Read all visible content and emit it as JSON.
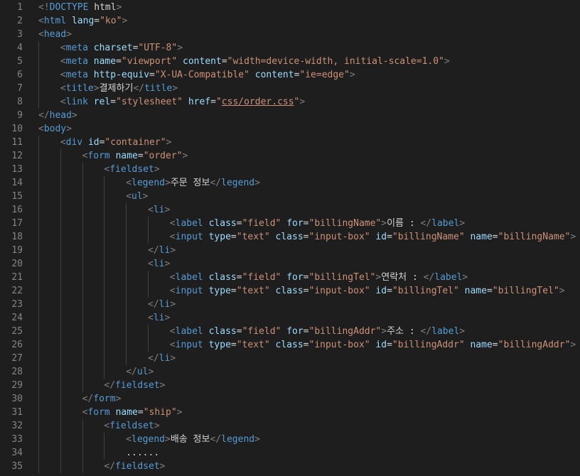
{
  "colors": {
    "background": "#1e1e1e",
    "line_number": "#858585",
    "indent_guide": "#404040",
    "bracket": "#808080",
    "tag": "#569cd6",
    "attribute": "#9cdcfe",
    "string": "#ce9178",
    "text": "#d4d4d4"
  },
  "lines": [
    {
      "n": "1",
      "indent": 0,
      "tokens": [
        [
          "bracket",
          "<!"
        ],
        [
          "tag",
          "DOCTYPE"
        ],
        [
          "text",
          " "
        ],
        [
          "kw",
          "html"
        ],
        [
          "bracket",
          ">"
        ]
      ]
    },
    {
      "n": "2",
      "indent": 0,
      "tokens": [
        [
          "bracket",
          "<"
        ],
        [
          "tag",
          "html"
        ],
        [
          "text",
          " "
        ],
        [
          "attr",
          "lang"
        ],
        [
          "eq",
          "="
        ],
        [
          "str",
          "\"ko\""
        ],
        [
          "bracket",
          ">"
        ]
      ]
    },
    {
      "n": "3",
      "indent": 0,
      "tokens": [
        [
          "bracket",
          "<"
        ],
        [
          "tag",
          "head"
        ],
        [
          "bracket",
          ">"
        ]
      ]
    },
    {
      "n": "4",
      "indent": 1,
      "tokens": [
        [
          "bracket",
          "<"
        ],
        [
          "tag",
          "meta"
        ],
        [
          "text",
          " "
        ],
        [
          "attr",
          "charset"
        ],
        [
          "eq",
          "="
        ],
        [
          "str",
          "\"UTF-8\""
        ],
        [
          "bracket",
          ">"
        ]
      ]
    },
    {
      "n": "5",
      "indent": 1,
      "tokens": [
        [
          "bracket",
          "<"
        ],
        [
          "tag",
          "meta"
        ],
        [
          "text",
          " "
        ],
        [
          "attr",
          "name"
        ],
        [
          "eq",
          "="
        ],
        [
          "str",
          "\"viewport\""
        ],
        [
          "text",
          " "
        ],
        [
          "attr",
          "content"
        ],
        [
          "eq",
          "="
        ],
        [
          "str",
          "\"width=device-width, initial-scale=1.0\""
        ],
        [
          "bracket",
          ">"
        ]
      ]
    },
    {
      "n": "6",
      "indent": 1,
      "tokens": [
        [
          "bracket",
          "<"
        ],
        [
          "tag",
          "meta"
        ],
        [
          "text",
          " "
        ],
        [
          "attr",
          "http-equiv"
        ],
        [
          "eq",
          "="
        ],
        [
          "str",
          "\"X-UA-Compatible\""
        ],
        [
          "text",
          " "
        ],
        [
          "attr",
          "content"
        ],
        [
          "eq",
          "="
        ],
        [
          "str",
          "\"ie=edge\""
        ],
        [
          "bracket",
          ">"
        ]
      ]
    },
    {
      "n": "7",
      "indent": 1,
      "tokens": [
        [
          "bracket",
          "<"
        ],
        [
          "tag",
          "title"
        ],
        [
          "bracket",
          ">"
        ],
        [
          "text",
          "결제하기"
        ],
        [
          "bracket",
          "</"
        ],
        [
          "tag",
          "title"
        ],
        [
          "bracket",
          ">"
        ]
      ]
    },
    {
      "n": "8",
      "indent": 1,
      "tokens": [
        [
          "bracket",
          "<"
        ],
        [
          "tag",
          "link"
        ],
        [
          "text",
          " "
        ],
        [
          "attr",
          "rel"
        ],
        [
          "eq",
          "="
        ],
        [
          "str",
          "\"stylesheet\""
        ],
        [
          "text",
          " "
        ],
        [
          "attr",
          "href"
        ],
        [
          "eq",
          "="
        ],
        [
          "str",
          "\""
        ],
        [
          "link",
          "css/order.css"
        ],
        [
          "str",
          "\""
        ],
        [
          "bracket",
          ">"
        ]
      ]
    },
    {
      "n": "9",
      "indent": 0,
      "tokens": [
        [
          "bracket",
          "</"
        ],
        [
          "tag",
          "head"
        ],
        [
          "bracket",
          ">"
        ]
      ]
    },
    {
      "n": "10",
      "indent": 0,
      "tokens": [
        [
          "bracket",
          "<"
        ],
        [
          "tag",
          "body"
        ],
        [
          "bracket",
          ">"
        ]
      ]
    },
    {
      "n": "11",
      "indent": 1,
      "tokens": [
        [
          "bracket",
          "<"
        ],
        [
          "tag",
          "div"
        ],
        [
          "text",
          " "
        ],
        [
          "attr",
          "id"
        ],
        [
          "eq",
          "="
        ],
        [
          "str",
          "\"container\""
        ],
        [
          "bracket",
          ">"
        ]
      ]
    },
    {
      "n": "12",
      "indent": 2,
      "tokens": [
        [
          "bracket",
          "<"
        ],
        [
          "tag",
          "form"
        ],
        [
          "text",
          " "
        ],
        [
          "attr",
          "name"
        ],
        [
          "eq",
          "="
        ],
        [
          "str",
          "\"order\""
        ],
        [
          "bracket",
          ">"
        ]
      ]
    },
    {
      "n": "13",
      "indent": 3,
      "tokens": [
        [
          "bracket",
          "<"
        ],
        [
          "tag",
          "fieldset"
        ],
        [
          "bracket",
          ">"
        ]
      ]
    },
    {
      "n": "14",
      "indent": 4,
      "tokens": [
        [
          "bracket",
          "<"
        ],
        [
          "tag",
          "legend"
        ],
        [
          "bracket",
          ">"
        ],
        [
          "text",
          "주문 정보"
        ],
        [
          "bracket",
          "</"
        ],
        [
          "tag",
          "legend"
        ],
        [
          "bracket",
          ">"
        ]
      ]
    },
    {
      "n": "15",
      "indent": 4,
      "tokens": [
        [
          "bracket",
          "<"
        ],
        [
          "tag",
          "ul"
        ],
        [
          "bracket",
          ">"
        ]
      ]
    },
    {
      "n": "16",
      "indent": 5,
      "tokens": [
        [
          "bracket",
          "<"
        ],
        [
          "tag",
          "li"
        ],
        [
          "bracket",
          ">"
        ]
      ]
    },
    {
      "n": "17",
      "indent": 6,
      "tokens": [
        [
          "bracket",
          "<"
        ],
        [
          "tag",
          "label"
        ],
        [
          "text",
          " "
        ],
        [
          "attr",
          "class"
        ],
        [
          "eq",
          "="
        ],
        [
          "str",
          "\"field\""
        ],
        [
          "text",
          " "
        ],
        [
          "attr",
          "for"
        ],
        [
          "eq",
          "="
        ],
        [
          "str",
          "\"billingName\""
        ],
        [
          "bracket",
          ">"
        ],
        [
          "text",
          "이름 : "
        ],
        [
          "bracket",
          "</"
        ],
        [
          "tag",
          "label"
        ],
        [
          "bracket",
          ">"
        ]
      ]
    },
    {
      "n": "18",
      "indent": 6,
      "tokens": [
        [
          "bracket",
          "<"
        ],
        [
          "tag",
          "input"
        ],
        [
          "text",
          " "
        ],
        [
          "attr",
          "type"
        ],
        [
          "eq",
          "="
        ],
        [
          "str",
          "\"text\""
        ],
        [
          "text",
          " "
        ],
        [
          "attr",
          "class"
        ],
        [
          "eq",
          "="
        ],
        [
          "str",
          "\"input-box\""
        ],
        [
          "text",
          " "
        ],
        [
          "attr",
          "id"
        ],
        [
          "eq",
          "="
        ],
        [
          "str",
          "\"billingName\""
        ],
        [
          "text",
          " "
        ],
        [
          "attr",
          "name"
        ],
        [
          "eq",
          "="
        ],
        [
          "str",
          "\"billingName\""
        ],
        [
          "bracket",
          ">"
        ]
      ]
    },
    {
      "n": "19",
      "indent": 5,
      "tokens": [
        [
          "bracket",
          "</"
        ],
        [
          "tag",
          "li"
        ],
        [
          "bracket",
          ">"
        ]
      ]
    },
    {
      "n": "20",
      "indent": 5,
      "tokens": [
        [
          "bracket",
          "<"
        ],
        [
          "tag",
          "li"
        ],
        [
          "bracket",
          ">"
        ]
      ]
    },
    {
      "n": "21",
      "indent": 6,
      "tokens": [
        [
          "bracket",
          "<"
        ],
        [
          "tag",
          "label"
        ],
        [
          "text",
          " "
        ],
        [
          "attr",
          "class"
        ],
        [
          "eq",
          "="
        ],
        [
          "str",
          "\"field\""
        ],
        [
          "text",
          " "
        ],
        [
          "attr",
          "for"
        ],
        [
          "eq",
          "="
        ],
        [
          "str",
          "\"billingTel\""
        ],
        [
          "bracket",
          ">"
        ],
        [
          "text",
          "연락처 : "
        ],
        [
          "bracket",
          "</"
        ],
        [
          "tag",
          "label"
        ],
        [
          "bracket",
          ">"
        ]
      ]
    },
    {
      "n": "22",
      "indent": 6,
      "tokens": [
        [
          "bracket",
          "<"
        ],
        [
          "tag",
          "input"
        ],
        [
          "text",
          " "
        ],
        [
          "attr",
          "type"
        ],
        [
          "eq",
          "="
        ],
        [
          "str",
          "\"text\""
        ],
        [
          "text",
          " "
        ],
        [
          "attr",
          "class"
        ],
        [
          "eq",
          "="
        ],
        [
          "str",
          "\"input-box\""
        ],
        [
          "text",
          " "
        ],
        [
          "attr",
          "id"
        ],
        [
          "eq",
          "="
        ],
        [
          "str",
          "\"billingTel\""
        ],
        [
          "text",
          " "
        ],
        [
          "attr",
          "name"
        ],
        [
          "eq",
          "="
        ],
        [
          "str",
          "\"billingTel\""
        ],
        [
          "bracket",
          ">"
        ]
      ]
    },
    {
      "n": "23",
      "indent": 5,
      "tokens": [
        [
          "bracket",
          "</"
        ],
        [
          "tag",
          "li"
        ],
        [
          "bracket",
          ">"
        ]
      ]
    },
    {
      "n": "24",
      "indent": 5,
      "tokens": [
        [
          "bracket",
          "<"
        ],
        [
          "tag",
          "li"
        ],
        [
          "bracket",
          ">"
        ]
      ]
    },
    {
      "n": "25",
      "indent": 6,
      "tokens": [
        [
          "bracket",
          "<"
        ],
        [
          "tag",
          "label"
        ],
        [
          "text",
          " "
        ],
        [
          "attr",
          "class"
        ],
        [
          "eq",
          "="
        ],
        [
          "str",
          "\"field\""
        ],
        [
          "text",
          " "
        ],
        [
          "attr",
          "for"
        ],
        [
          "eq",
          "="
        ],
        [
          "str",
          "\"billingAddr\""
        ],
        [
          "bracket",
          ">"
        ],
        [
          "text",
          "주소 : "
        ],
        [
          "bracket",
          "</"
        ],
        [
          "tag",
          "label"
        ],
        [
          "bracket",
          ">"
        ]
      ]
    },
    {
      "n": "26",
      "indent": 6,
      "tokens": [
        [
          "bracket",
          "<"
        ],
        [
          "tag",
          "input"
        ],
        [
          "text",
          " "
        ],
        [
          "attr",
          "type"
        ],
        [
          "eq",
          "="
        ],
        [
          "str",
          "\"text\""
        ],
        [
          "text",
          " "
        ],
        [
          "attr",
          "class"
        ],
        [
          "eq",
          "="
        ],
        [
          "str",
          "\"input-box\""
        ],
        [
          "text",
          " "
        ],
        [
          "attr",
          "id"
        ],
        [
          "eq",
          "="
        ],
        [
          "str",
          "\"billingAddr\""
        ],
        [
          "text",
          " "
        ],
        [
          "attr",
          "name"
        ],
        [
          "eq",
          "="
        ],
        [
          "str",
          "\"billingAddr\""
        ],
        [
          "bracket",
          ">"
        ]
      ]
    },
    {
      "n": "27",
      "indent": 5,
      "tokens": [
        [
          "bracket",
          "</"
        ],
        [
          "tag",
          "li"
        ],
        [
          "bracket",
          ">"
        ]
      ]
    },
    {
      "n": "28",
      "indent": 4,
      "tokens": [
        [
          "bracket",
          "</"
        ],
        [
          "tag",
          "ul"
        ],
        [
          "bracket",
          ">"
        ]
      ]
    },
    {
      "n": "29",
      "indent": 3,
      "tokens": [
        [
          "bracket",
          "</"
        ],
        [
          "tag",
          "fieldset"
        ],
        [
          "bracket",
          ">"
        ]
      ]
    },
    {
      "n": "30",
      "indent": 2,
      "tokens": [
        [
          "bracket",
          "</"
        ],
        [
          "tag",
          "form"
        ],
        [
          "bracket",
          ">"
        ]
      ]
    },
    {
      "n": "31",
      "indent": 2,
      "tokens": [
        [
          "bracket",
          "<"
        ],
        [
          "tag",
          "form"
        ],
        [
          "text",
          " "
        ],
        [
          "attr",
          "name"
        ],
        [
          "eq",
          "="
        ],
        [
          "str",
          "\"ship\""
        ],
        [
          "bracket",
          ">"
        ]
      ]
    },
    {
      "n": "32",
      "indent": 3,
      "tokens": [
        [
          "bracket",
          "<"
        ],
        [
          "tag",
          "fieldset"
        ],
        [
          "bracket",
          ">"
        ]
      ]
    },
    {
      "n": "33",
      "indent": 4,
      "tokens": [
        [
          "bracket",
          "<"
        ],
        [
          "tag",
          "legend"
        ],
        [
          "bracket",
          ">"
        ],
        [
          "text",
          "배송 정보"
        ],
        [
          "bracket",
          "</"
        ],
        [
          "tag",
          "legend"
        ],
        [
          "bracket",
          ">"
        ]
      ]
    },
    {
      "n": "34",
      "indent": 4,
      "tokens": [
        [
          "text",
          "......"
        ]
      ]
    },
    {
      "n": "35",
      "indent": 3,
      "tokens": [
        [
          "bracket",
          "</"
        ],
        [
          "tag",
          "fieldset"
        ],
        [
          "bracket",
          ">"
        ]
      ]
    }
  ]
}
